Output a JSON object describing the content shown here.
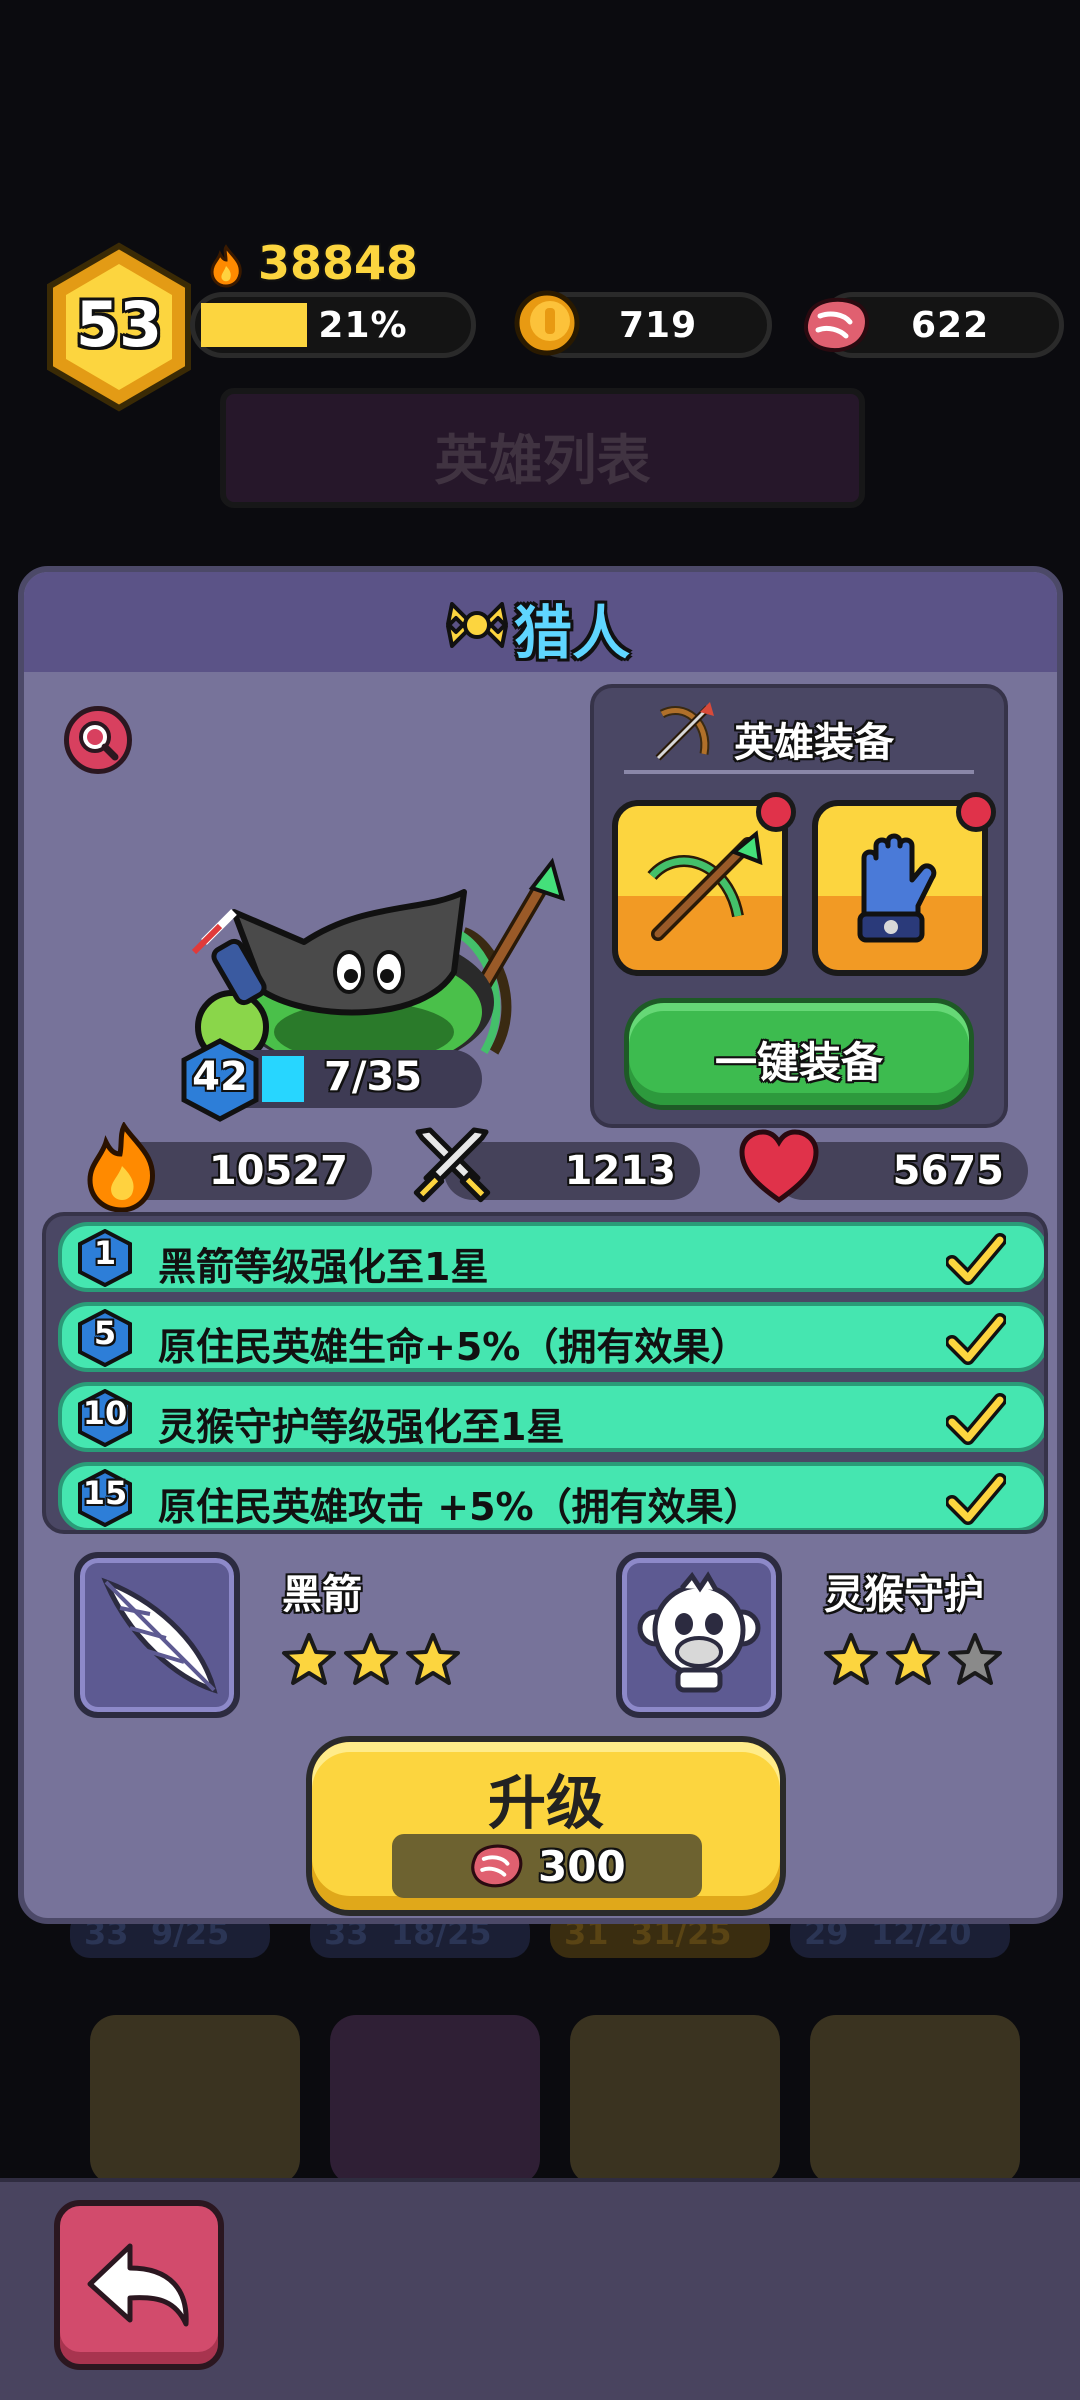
{
  "player": {
    "level": "53",
    "power": "38848",
    "exp_percent_label": "21%",
    "exp_fraction": 0.21,
    "gold": "719",
    "meat": "622"
  },
  "background": {
    "header_title": "英雄列表",
    "bottom_cards": [
      {
        "level": "33",
        "progress": "9/25"
      },
      {
        "level": "33",
        "progress": "18/25"
      },
      {
        "level": "31",
        "progress": "31/25"
      },
      {
        "level": "29",
        "progress": "12/20"
      }
    ]
  },
  "hero": {
    "name": "猎人",
    "level": "42",
    "shards": "7/35",
    "shard_fraction": 0.2,
    "power": "10527",
    "attack": "1213",
    "hp": "5675"
  },
  "equipment": {
    "title": "英雄装备",
    "one_click_label": "一键装备",
    "slots": [
      {
        "icon": "crossbow-icon",
        "has_alert": true
      },
      {
        "icon": "glove-icon",
        "has_alert": true
      }
    ]
  },
  "bonuses": [
    {
      "level": "1",
      "text": "黑箭等级强化至1星",
      "done": true
    },
    {
      "level": "5",
      "text": "原住民英雄生命+5%（拥有效果）",
      "done": true
    },
    {
      "level": "10",
      "text": "灵猴守护等级强化至1星",
      "done": true
    },
    {
      "level": "15",
      "text": "原住民英雄攻击  +5%（拥有效果）",
      "done": true
    }
  ],
  "skills": [
    {
      "name": "黑箭",
      "icon": "feather-arrow-icon",
      "stars": 3,
      "max_stars": 3
    },
    {
      "name": "灵猴守护",
      "icon": "monkey-icon",
      "stars": 2,
      "max_stars": 3
    }
  ],
  "upgrade": {
    "label": "升级",
    "cost": "300"
  },
  "colors": {
    "accent_yellow": "#fcd53f",
    "bonus_green": "#45e6b0",
    "equip_green": "#3dbb4f",
    "panel": "#77739a",
    "back_button": "#d24b6c"
  }
}
